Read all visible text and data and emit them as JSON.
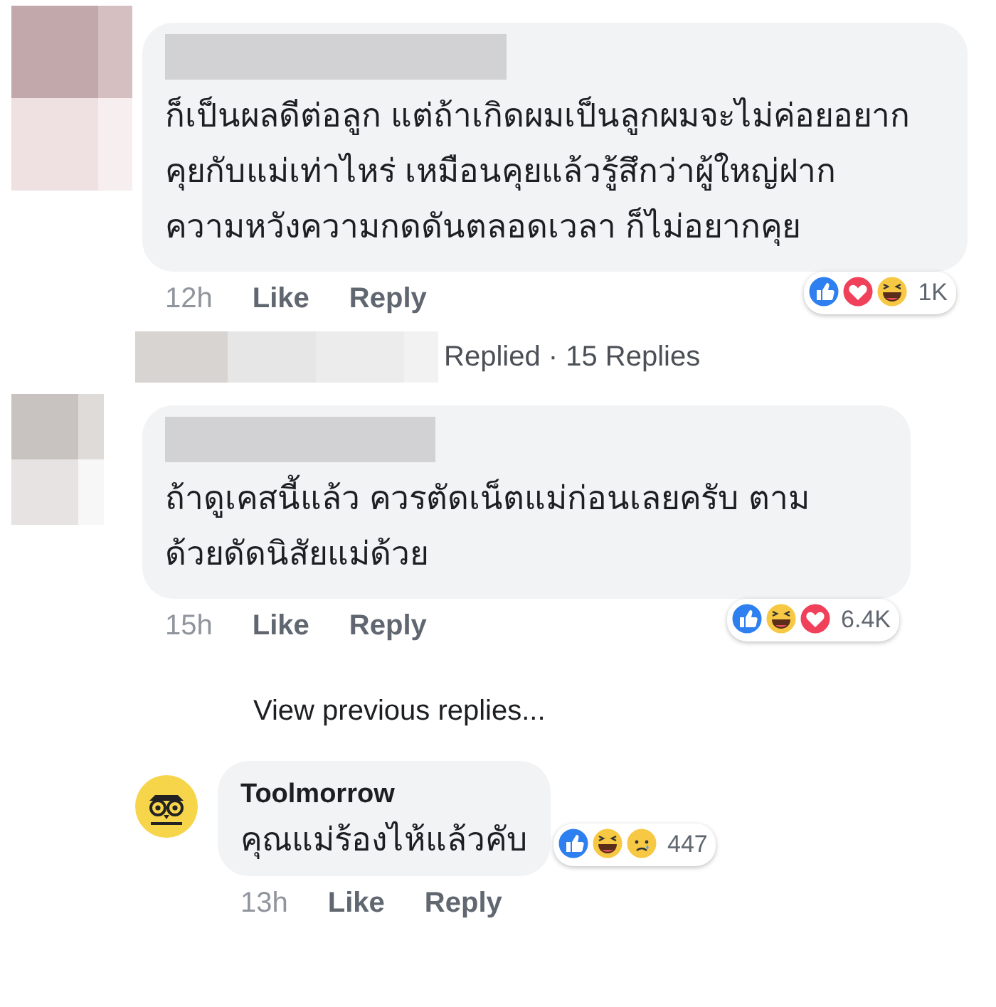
{
  "comments": [
    {
      "avatar": {
        "kind": "blurred"
      },
      "text": "ก็เป็นผลดีต่อลูก แต่ถ้าเกิดผมเป็นลูกผมจะไม่ค่อยอยากคุยกับแม่เท่าไหร่ เหมือนคุยแล้วรู้สึกว่าผู้ใหญ่ฝากความหวังความกดดันตลอดเวลา ก็ไม่อยากคุย",
      "time": "12h",
      "like": "Like",
      "reply": "Reply",
      "reactions": [
        {
          "kind": "like"
        },
        {
          "kind": "love"
        },
        {
          "kind": "haha"
        }
      ],
      "reaction_count": "1K",
      "replied": {
        "text": "Replied · 15 Replies"
      }
    },
    {
      "avatar": {
        "kind": "blurred"
      },
      "text": "ถ้าดูเคสนี้แล้ว ควรตัดเน็ตแม่ก่อนเลยครับ ตามด้วยดัดนิสัยแม่ด้วย",
      "time": "15h",
      "like": "Like",
      "reply": "Reply",
      "reactions": [
        {
          "kind": "like"
        },
        {
          "kind": "haha"
        },
        {
          "kind": "love"
        }
      ],
      "reaction_count": "6.4K"
    }
  ],
  "view_previous": "View previous replies...",
  "reply": {
    "avatar": {
      "kind": "logo"
    },
    "name": "Toolmorrow",
    "text": "คุณแม่ร้องไห้แล้วคับ",
    "time": "13h",
    "like": "Like",
    "reply": "Reply",
    "reactions": [
      {
        "kind": "like"
      },
      {
        "kind": "haha"
      },
      {
        "kind": "sad"
      }
    ],
    "reaction_count": "447"
  }
}
